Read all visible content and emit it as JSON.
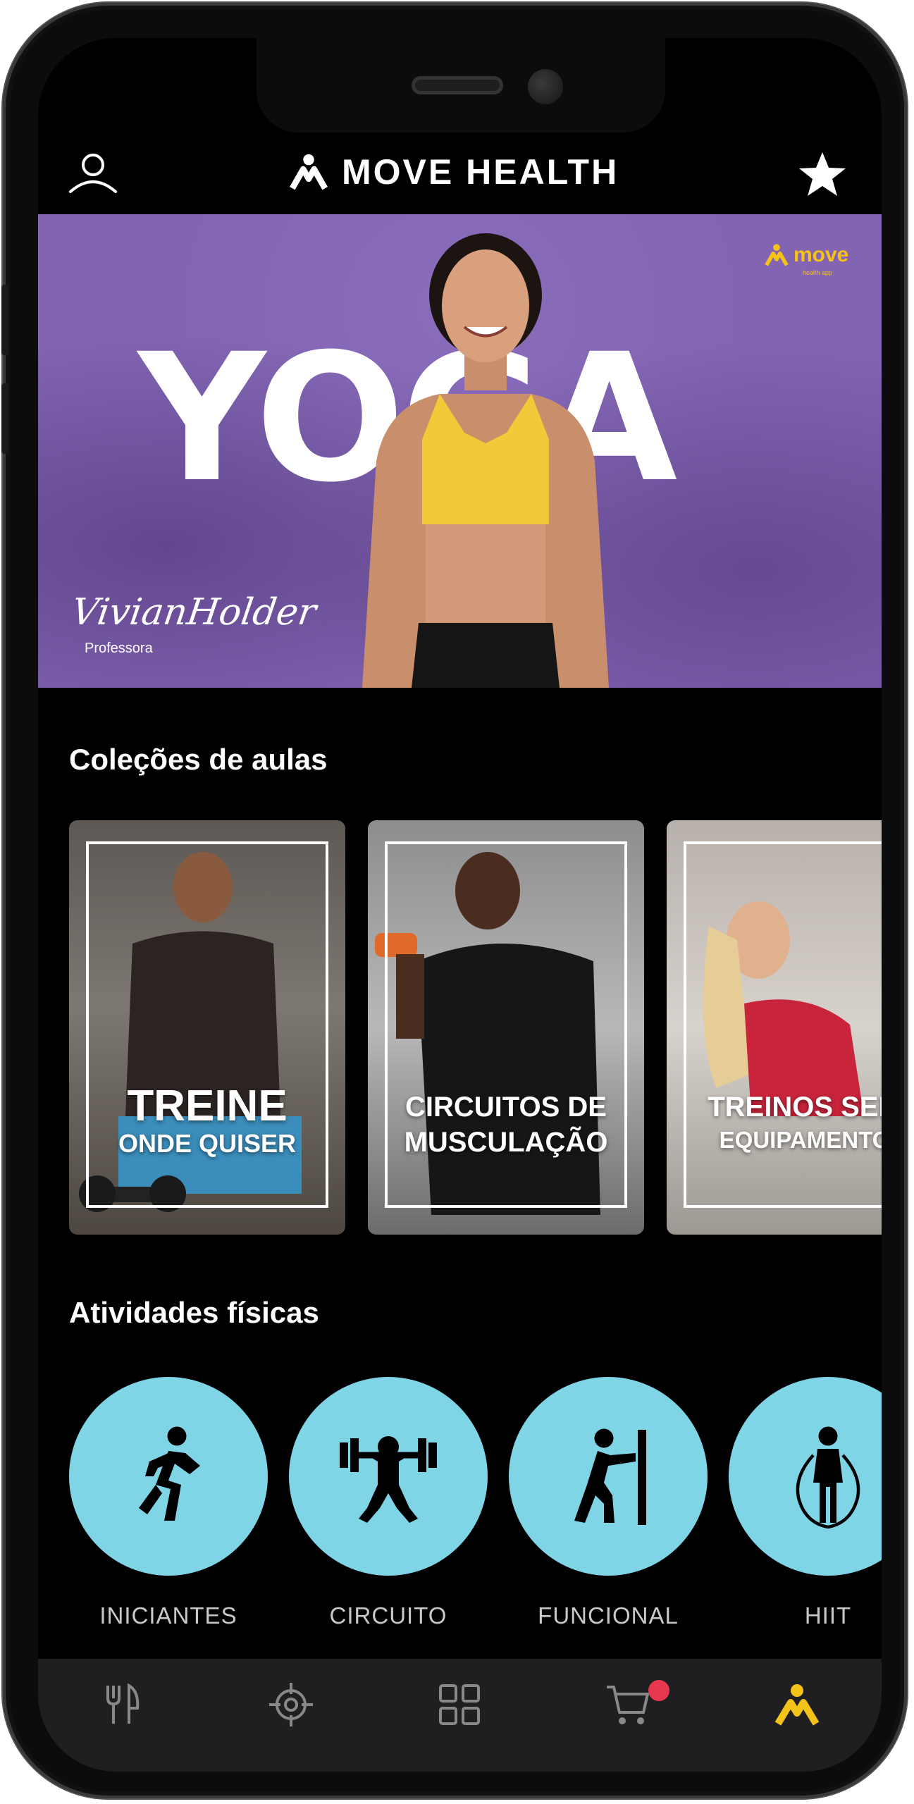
{
  "header": {
    "brand_name": "MOVE HEALTH",
    "profile_icon": "user-icon",
    "favorite_icon": "star-icon"
  },
  "banner": {
    "title": "YOGA",
    "logo_text": "move",
    "logo_subtext": "health app",
    "signature": "VivianHolder",
    "role": "Professora",
    "background_color": "#8264b2",
    "logo_color": "#f5c218"
  },
  "collections": {
    "title": "Coleções de aulas",
    "cards": [
      {
        "line1": "TREINE",
        "line2": "ONDE QUISER"
      },
      {
        "line1": "CIRCUITOS DE",
        "line2": "MUSCULAÇÃO"
      },
      {
        "line1": "TREINOS SEM",
        "line2": "EQUIPAMENTO"
      }
    ]
  },
  "activities": {
    "title": "Atividades físicas",
    "items": [
      {
        "label": "INICIANTES",
        "icon": "running-person-icon"
      },
      {
        "label": "CIRCUITO",
        "icon": "weightlifter-icon"
      },
      {
        "label": "FUNCIONAL",
        "icon": "wall-push-icon"
      },
      {
        "label": "HIIT",
        "icon": "jump-rope-icon"
      }
    ],
    "circle_color": "#7fd4e6"
  },
  "bottom_nav": {
    "items": [
      {
        "name": "fork-knife-icon"
      },
      {
        "name": "target-icon"
      },
      {
        "name": "grid-icon"
      },
      {
        "name": "cart-icon",
        "badge": true
      },
      {
        "name": "move-logo-icon",
        "active": true
      }
    ],
    "active_color": "#f5c218",
    "badge_color": "#e8384f"
  }
}
